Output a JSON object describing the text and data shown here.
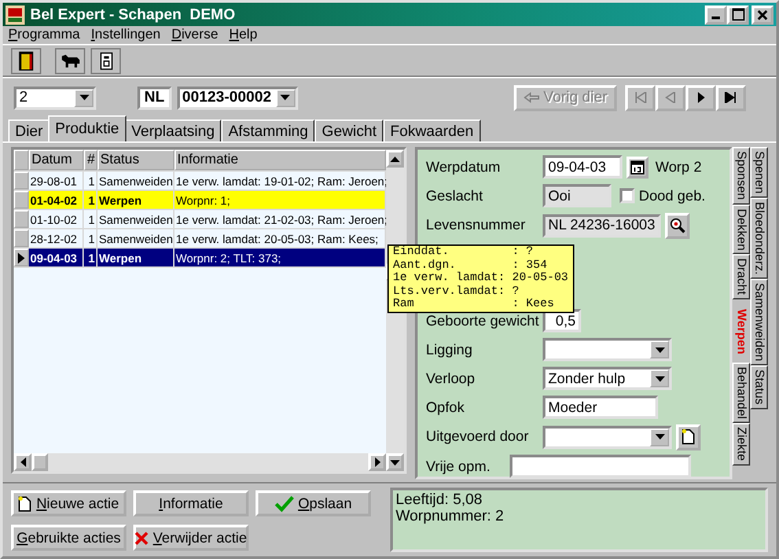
{
  "window": {
    "title": "Bel Expert - Schapen  DEMO"
  },
  "menu": [
    "Programma",
    "Instellingen",
    "Diverse",
    "Help"
  ],
  "selector": {
    "group": "2",
    "country": "NL",
    "number": "00123-00002"
  },
  "nav": {
    "previous": {
      "label": "Vorig dier",
      "disabled": true
    },
    "buttons": [
      {
        "kind": "first",
        "disabled": true
      },
      {
        "kind": "prev",
        "disabled": true
      },
      {
        "kind": "next",
        "disabled": false
      },
      {
        "kind": "last",
        "disabled": false
      }
    ]
  },
  "tabs": [
    {
      "label": "Dier",
      "selected": false
    },
    {
      "label": "Produktie",
      "selected": true
    },
    {
      "label": "Verplaatsing",
      "selected": false
    },
    {
      "label": "Afstamming",
      "selected": false
    },
    {
      "label": "Gewicht",
      "selected": false
    },
    {
      "label": "Fokwaarden",
      "selected": false
    }
  ],
  "table": {
    "columns": [
      "Datum",
      "#",
      "Status",
      "Informatie"
    ],
    "rows": [
      {
        "cells": [
          "29-08-01",
          "1",
          "Samenweiden",
          "1e verw. lamdat: 19-01-02; Ram: Jeroen;"
        ],
        "highlighted": false,
        "selected": false
      },
      {
        "cells": [
          "01-04-02",
          "1",
          "Werpen",
          "Worpnr: 1;"
        ],
        "highlighted": true,
        "selected": false
      },
      {
        "cells": [
          "01-10-02",
          "1",
          "Samenweiden",
          "1e verw. lamdat: 21-02-03; Ram: Jeroen;"
        ],
        "highlighted": false,
        "selected": false
      },
      {
        "cells": [
          "28-12-02",
          "1",
          "Samenweiden",
          "1e verw. lamdat: 20-05-03; Ram: Kees;"
        ],
        "highlighted": false,
        "selected": false
      },
      {
        "cells": [
          "09-04-03",
          "1",
          "Werpen",
          "Worpnr: 2; TLT: 373;"
        ],
        "highlighted": false,
        "selected": true
      }
    ]
  },
  "form": {
    "werpdatum": {
      "label": "Werpdatum",
      "value": "09-04-03",
      "note": "Worp 2"
    },
    "geslacht": {
      "label": "Geslacht",
      "value": "Ooi",
      "checkbox": {
        "label": "Dood geb.",
        "checked": false
      }
    },
    "levensnummer": {
      "label": "Levensnummer",
      "value": "NL 24236-16003"
    },
    "gewicht": {
      "label": "Geboorte gewicht",
      "value": "0,5"
    },
    "ligging": {
      "label": "Ligging"
    },
    "verloop": {
      "label": "Verloop",
      "value": "Zonder hulp"
    },
    "opfok": {
      "label": "Opfok",
      "value": "Moeder"
    },
    "uitgevoerd": {
      "label": "Uitgevoerd door"
    },
    "opmerking": {
      "label": "Vrije opm."
    }
  },
  "tooltip": [
    "Einddat.         : ?",
    "Aant.dgn.        : 354",
    "1e verw. lamdat: 20-05-03",
    "Lts.verv.lamdat: ?",
    "Ram              : Kees"
  ],
  "side_tabs": {
    "inner": [
      {
        "label": "Sponsen",
        "selected": false
      },
      {
        "label": "Dekken",
        "selected": false
      },
      {
        "label": "Dracht",
        "selected": false
      },
      {
        "label": "Werpen",
        "selected": true
      },
      {
        "label": "Behandel",
        "selected": false
      },
      {
        "label": "Ziekte",
        "selected": false
      }
    ],
    "outer": [
      {
        "label": "Spenen",
        "selected": false
      },
      {
        "label": "Bloedonderz.",
        "selected": false
      },
      {
        "label": "Samenweiden",
        "selected": false
      },
      {
        "label": "Status",
        "selected": false
      }
    ]
  },
  "actions": [
    "Nieuwe actie",
    "Informatie",
    "Opslaan",
    "Gebruikte acties",
    "Verwijder actie"
  ],
  "info": [
    "Leeftijd: 5,08",
    "Worpnummer: 2"
  ]
}
